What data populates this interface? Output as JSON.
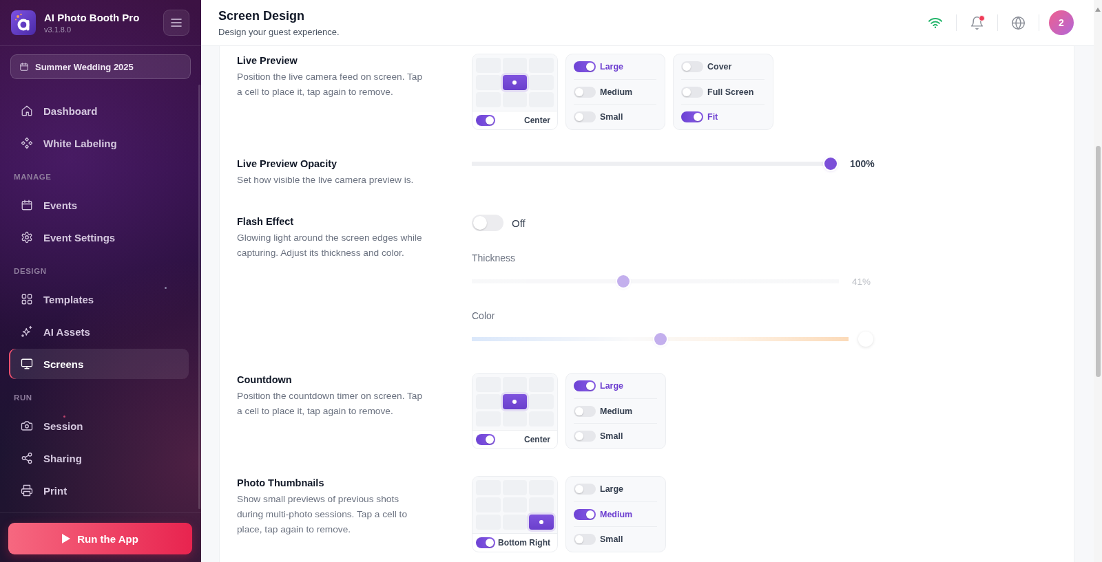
{
  "sidebar": {
    "app_name": "AI Photo Booth Pro",
    "version": "v3.1.8.0",
    "event": "Summer Wedding 2025",
    "sections": [
      {
        "items": [
          {
            "label": "Dashboard",
            "selected": false
          },
          {
            "label": "White Labeling",
            "selected": false
          }
        ]
      },
      {
        "heading": "MANAGE",
        "items": [
          {
            "label": "Events",
            "selected": false
          },
          {
            "label": "Event Settings",
            "selected": false
          }
        ]
      },
      {
        "heading": "DESIGN",
        "items": [
          {
            "label": "Templates",
            "selected": false
          },
          {
            "label": "AI Assets",
            "selected": false
          },
          {
            "label": "Screens",
            "selected": true
          }
        ]
      },
      {
        "heading": "RUN",
        "items": [
          {
            "label": "Session",
            "selected": false
          },
          {
            "label": "Sharing",
            "selected": false
          },
          {
            "label": "Print",
            "selected": false
          }
        ]
      }
    ],
    "run_button": "Run the App"
  },
  "header": {
    "title": "Screen Design",
    "subtitle": "Design your guest experience.",
    "online": true,
    "unread_notifications": true,
    "avatar": "2"
  },
  "settings": [
    {
      "kind": "position",
      "title": "Live Preview",
      "description": "Position the live camera feed on screen. Tap a cell to place it, tap again to remove.",
      "placement": {
        "enabled": true,
        "label": "Center",
        "cells": [
          {
            "selected": false
          },
          {
            "selected": false
          },
          {
            "selected": false
          },
          {
            "selected": false
          },
          {
            "selected": true
          },
          {
            "selected": false
          },
          {
            "selected": false
          },
          {
            "selected": false
          },
          {
            "selected": false
          }
        ]
      },
      "option_groups": [
        {
          "options": [
            {
              "label": "Large",
              "on": true
            },
            {
              "label": "Medium",
              "on": false
            },
            {
              "label": "Small",
              "on": false
            }
          ]
        },
        {
          "options": [
            {
              "label": "Cover",
              "on": false
            },
            {
              "label": "Full Screen",
              "on": false
            },
            {
              "label": "Fit",
              "on": true
            }
          ]
        }
      ]
    },
    {
      "kind": "slider",
      "title": "Live Preview Opacity",
      "description": "Set how visible the live camera preview is.",
      "level": 1,
      "reading": "100%"
    },
    {
      "kind": "flash",
      "title": "Flash Effect",
      "description": "Glowing light around the screen edges while capturing. Adjust its thickness and color.",
      "on": false,
      "state_label": "Off",
      "thickness": {
        "label": "Thickness",
        "level": 0.41,
        "reading": "41%"
      },
      "color": {
        "label": "Color",
        "level": 0.5
      }
    },
    {
      "kind": "position",
      "title": "Countdown",
      "description": "Position the countdown timer on screen. Tap a cell to place it, tap again to remove.",
      "placement": {
        "enabled": true,
        "label": "Center",
        "cells": [
          {
            "selected": false
          },
          {
            "selected": false
          },
          {
            "selected": false
          },
          {
            "selected": false
          },
          {
            "selected": true
          },
          {
            "selected": false
          },
          {
            "selected": false
          },
          {
            "selected": false
          },
          {
            "selected": false
          }
        ]
      },
      "option_groups": [
        {
          "options": [
            {
              "label": "Large",
              "on": true
            },
            {
              "label": "Medium",
              "on": false
            },
            {
              "label": "Small",
              "on": false
            }
          ]
        }
      ]
    },
    {
      "kind": "position",
      "title": "Photo Thumbnails",
      "description": "Show small previews of previous shots during multi-photo sessions. Tap a cell to place, tap again to remove.",
      "placement": {
        "enabled": true,
        "label": "Bottom Right",
        "cells": [
          {
            "selected": false
          },
          {
            "selected": false
          },
          {
            "selected": false
          },
          {
            "selected": false
          },
          {
            "selected": false
          },
          {
            "selected": false
          },
          {
            "selected": false
          },
          {
            "selected": false
          },
          {
            "selected": true
          }
        ]
      },
      "option_groups": [
        {
          "options": [
            {
              "label": "Large",
              "on": false
            },
            {
              "label": "Medium",
              "on": true
            },
            {
              "label": "Small",
              "on": false
            }
          ]
        }
      ]
    }
  ]
}
